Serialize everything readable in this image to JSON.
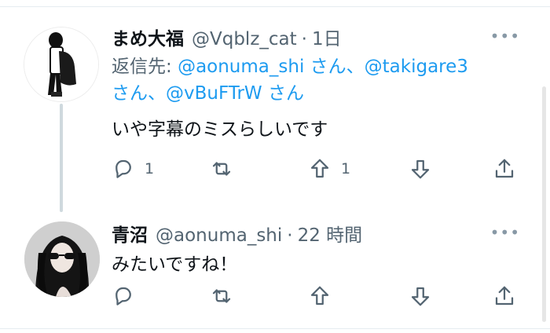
{
  "tweet1": {
    "name": "まめ大福",
    "handle": "@Vqblz_cat",
    "dot": "·",
    "time": "1日",
    "more": "•••",
    "reply_prefix": "返信先:",
    "mention1": "@aonuma_shi",
    "sep1": "さん、",
    "mention2": "@takigare3",
    "sep2": "さん、",
    "mention3": "@vBuFTrW",
    "sep3": "さん",
    "text": "いや字幕のミスらしいです",
    "reply_count": "1",
    "upvote_count": "1"
  },
  "tweet2": {
    "name": "青沼",
    "handle": "@aonuma_shi",
    "dot": "·",
    "time": "22 時間",
    "more": "•••",
    "text": "みたいですね！"
  },
  "icons": [
    "reply-icon",
    "retweet-icon",
    "upvote-icon",
    "downvote-icon",
    "share-icon"
  ]
}
